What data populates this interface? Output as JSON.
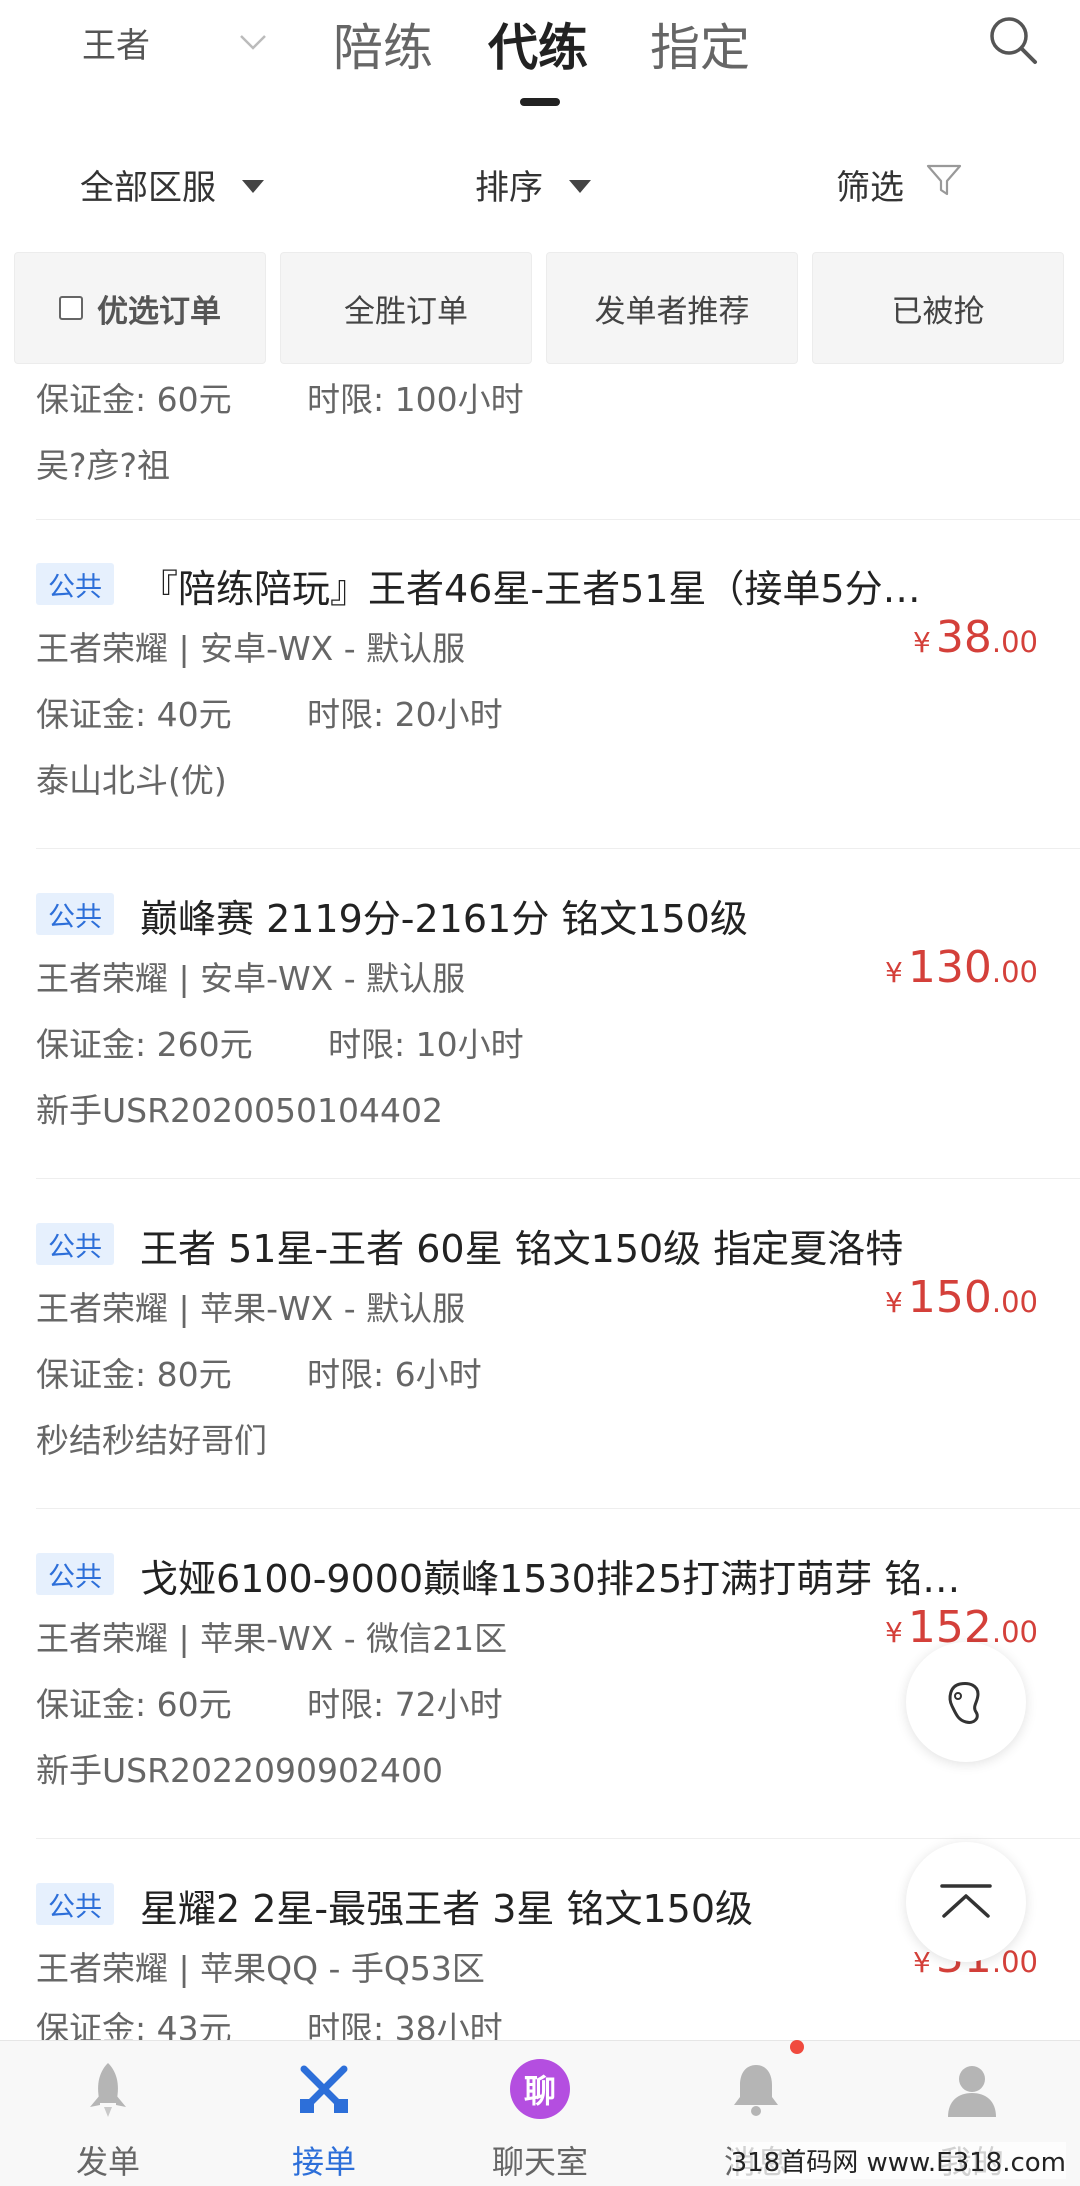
{
  "header": {
    "game": "王者",
    "tabs": [
      "陪练",
      "代练",
      "指定"
    ],
    "active_tab": "代练"
  },
  "filters": {
    "region": "全部区服",
    "sort": "排序",
    "filter": "筛选"
  },
  "chips": {
    "preferred": "优选订单",
    "all_win": "全胜订单",
    "recommended": "发单者推荐",
    "taken": "已被抢"
  },
  "partial_order": {
    "deposit": "保证金: 60元",
    "deadline": "时限: 100小时",
    "user": "吴?彦?祖"
  },
  "orders": [
    {
      "badge": "公共",
      "title": "『陪练陪玩』王者46星-王者51星（接单5分…",
      "server": "王者荣耀 | 安卓-WX - 默认服",
      "price_symbol": "¥",
      "price_int": "38",
      "price_dec": ".00",
      "deposit": "保证金: 40元",
      "deadline": "时限: 20小时",
      "user": "泰山北斗(优)"
    },
    {
      "badge": "公共",
      "title": "巅峰赛 2119分-2161分 铭文150级",
      "server": "王者荣耀 | 安卓-WX - 默认服",
      "price_symbol": "¥",
      "price_int": "130",
      "price_dec": ".00",
      "deposit": "保证金: 260元",
      "deadline": "时限: 10小时",
      "user": "新手USR2020050104402"
    },
    {
      "badge": "公共",
      "title": "王者 51星-王者 60星 铭文150级 指定夏洛特",
      "server": "王者荣耀 | 苹果-WX - 默认服",
      "price_symbol": "¥",
      "price_int": "150",
      "price_dec": ".00",
      "deposit": "保证金: 80元",
      "deadline": "时限: 6小时",
      "user": "秒结秒结好哥们"
    },
    {
      "badge": "公共",
      "title": "戈娅6100-9000巅峰1530排25打满打萌芽 铭…",
      "server": "王者荣耀 | 苹果-WX - 微信21区",
      "price_symbol": "¥",
      "price_int": "152",
      "price_dec": ".00",
      "deposit": "保证金: 60元",
      "deadline": "时限: 72小时",
      "user": "新手USR2022090902400"
    },
    {
      "badge": "公共",
      "title": "星耀2 2星-最强王者 3星 铭文150级",
      "server": "王者荣耀 | 苹果QQ - 手Q53区",
      "price_symbol": "¥",
      "price_int": "31",
      "price_dec": ".00",
      "deposit": "保证金: 43元",
      "deadline": "时限: 38小时",
      "user": ""
    }
  ],
  "bottom_nav": {
    "publish": "发单",
    "accept": "接单",
    "chat": "聊天室",
    "chat_icon_char": "聊",
    "messages": "消息",
    "mine": "我的",
    "active": "接单"
  },
  "watermark": "318首码网 www.E318.com"
}
